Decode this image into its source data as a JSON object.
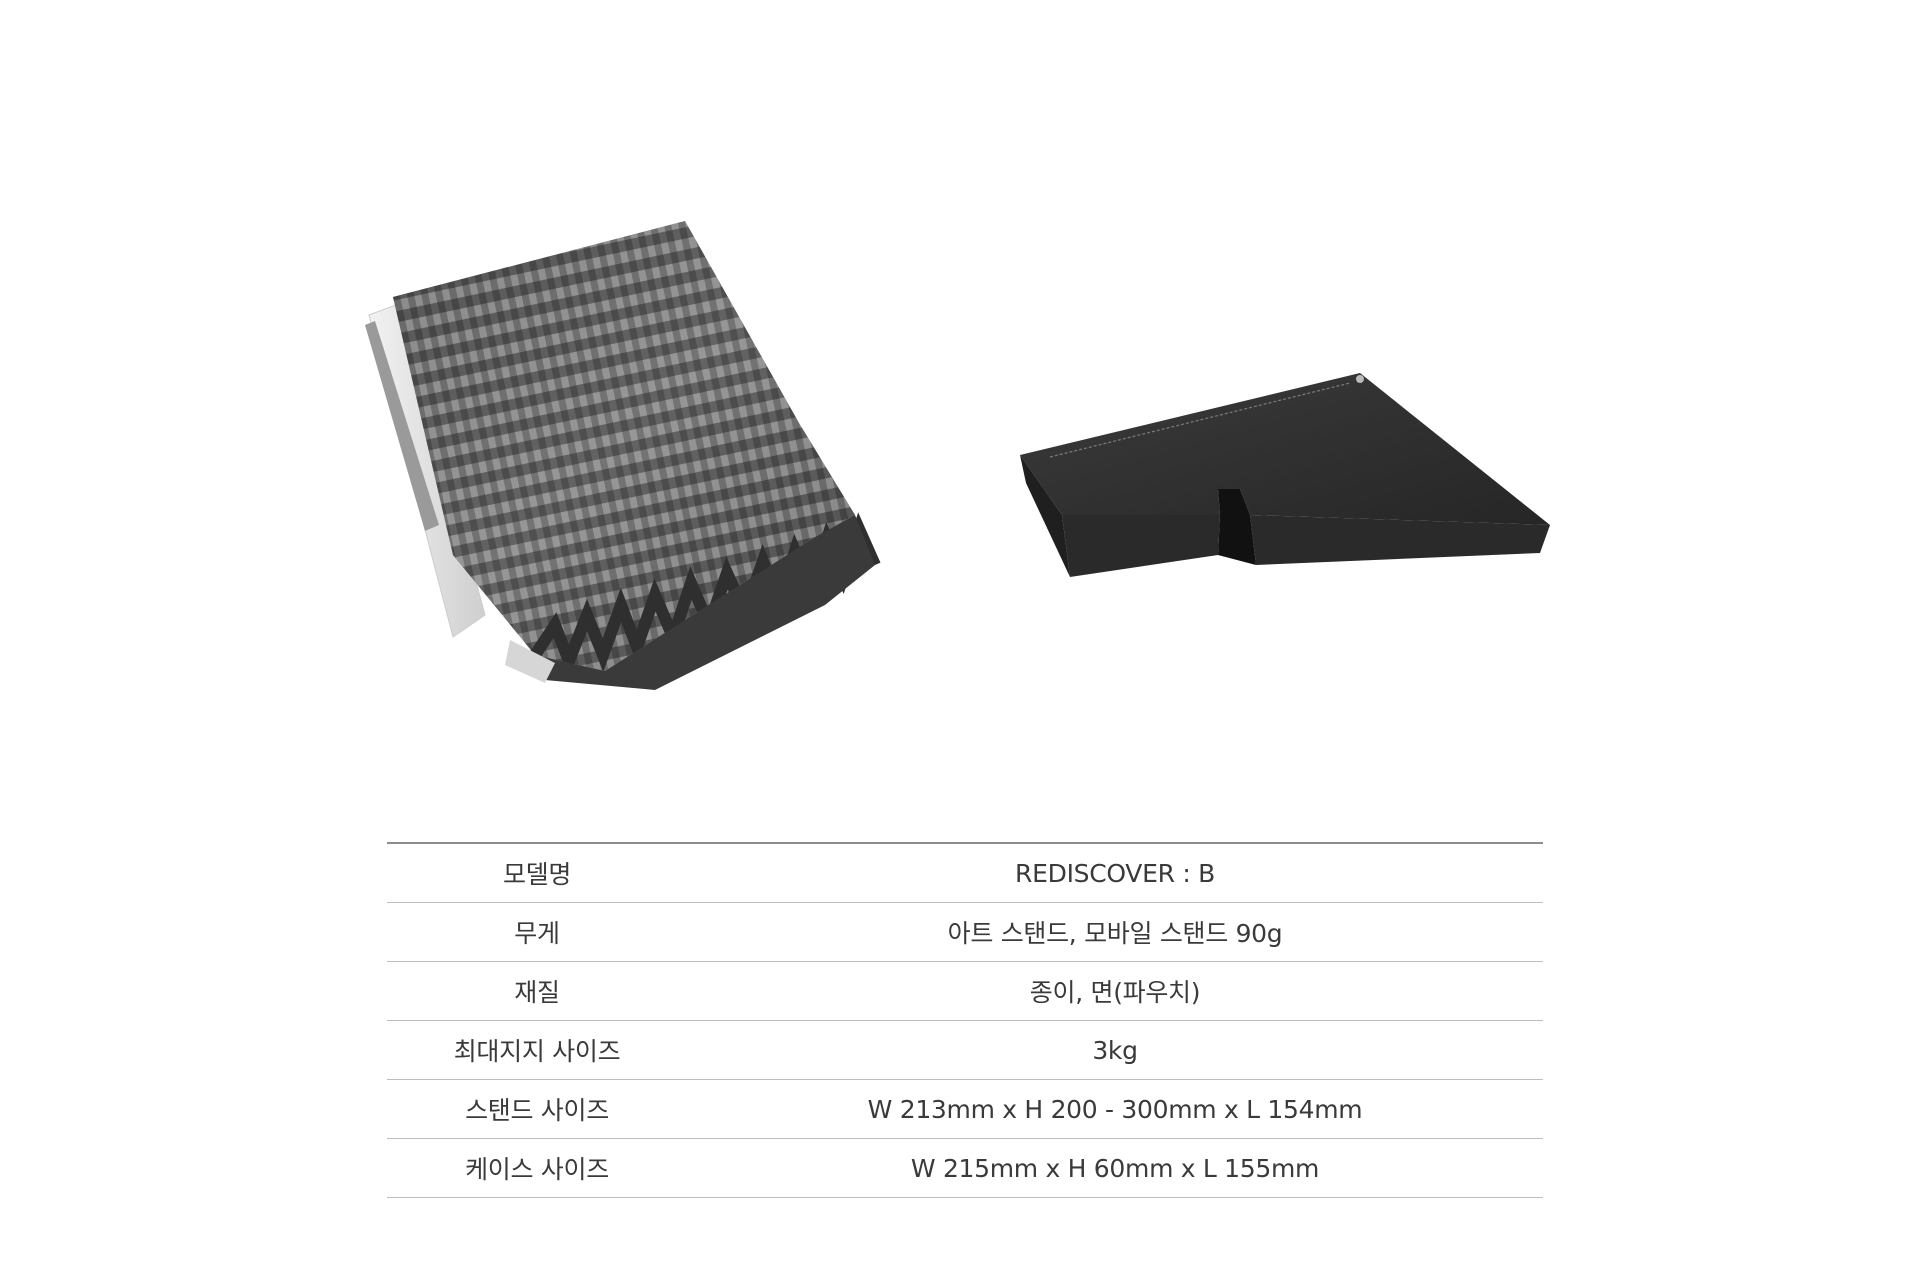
{
  "colors": {
    "text": "#3a3a3a",
    "rule": "#bdbdbd",
    "top_rule": "#8c8c8c",
    "product_dark": "#2f2f2f"
  },
  "images": {
    "stand": "product-stand-photo",
    "case": "product-case-photo"
  },
  "specs": [
    {
      "label": "모델명",
      "value": "REDISCOVER : B"
    },
    {
      "label": "무게",
      "value": "아트 스탠드, 모바일 스탠드  90g"
    },
    {
      "label": "재질",
      "value": "종이, 면(파우치)"
    },
    {
      "label": "최대지지 사이즈",
      "value": "3kg"
    },
    {
      "label": "스탠드 사이즈",
      "value": "W 213mm x H 200 - 300mm x L 154mm"
    },
    {
      "label": "케이스 사이즈",
      "value": "W 215mm x H 60mm x L 155mm"
    }
  ]
}
